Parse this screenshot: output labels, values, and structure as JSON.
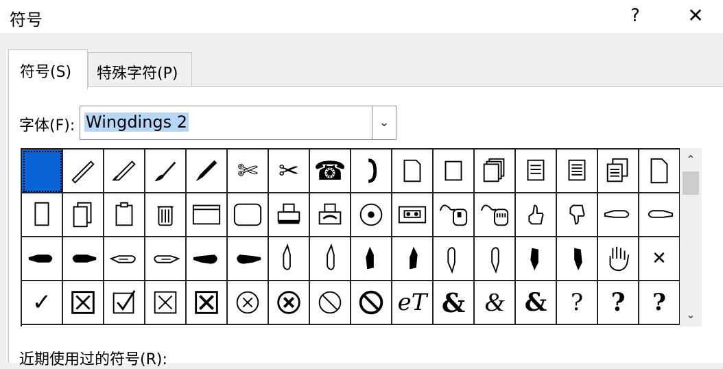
{
  "window": {
    "title": "符号",
    "help_label": "?",
    "close_label": "✕"
  },
  "tabs": [
    {
      "label": "符号(S)",
      "active": true
    },
    {
      "label": "特殊字符(P)",
      "active": false
    }
  ],
  "font": {
    "label": "字体(F):",
    "value": "Wingdings 2"
  },
  "symbol_grid": {
    "selected_index": 0,
    "rows": [
      [
        "selected",
        "pen-icon",
        "fountain-pen-icon",
        "brush-icon",
        "pencil-icon",
        "scissors-open-icon",
        "scissors-icon",
        "telephone-icon",
        "handset-icon",
        "document-folded-icon",
        "blank-page-icon",
        "stacked-pages-icon",
        "text-page-icon",
        "lined-page-icon",
        "stacked-text-pages-icon",
        "page-icon"
      ],
      [
        "tall-page-icon",
        "page-stack-icon",
        "clipboard-icon",
        "trash-can-icon",
        "window-icon",
        "rounded-rectangle-icon",
        "printer-icon",
        "fax-icon",
        "disc-icon",
        "cassette-icon",
        "mouse-icon",
        "mouse-keyboard-icon",
        "thumbs-up-icon",
        "thumbs-down-icon",
        "hand-point-left-icon",
        "hand-point-right-icon"
      ],
      [
        "black-hand-point-left-icon",
        "black-hand-point-right-icon",
        "outline-hand-left-icon",
        "outline-hand-right-icon",
        "black-fist-left-icon",
        "black-fist-right-icon",
        "hand-point-up-icon",
        "hand-point-up-alt-icon",
        "black-hand-up-icon",
        "black-hand-up-alt-icon",
        "hand-point-down-icon",
        "hand-point-down-alt-icon",
        "black-hand-down-icon",
        "black-hand-down-alt-icon",
        "open-hand-icon",
        "x-mark-icon"
      ],
      [
        "check-mark-icon",
        "x-box-icon",
        "check-box-icon",
        "x-box-thin-icon",
        "x-box-bold-icon",
        "circle-x-icon",
        "circle-x-bold-icon",
        "prohibited-icon",
        "prohibited-bold-icon",
        "et-ligature-icon",
        "ampersand-bold-icon",
        "ampersand-italic-icon",
        "ampersand-serif-icon",
        "interrobang-icon",
        "interrobang-bold-icon",
        "interrobang-alt-icon"
      ]
    ],
    "text_glyphs": {
      "check-mark-icon": "✓",
      "et-ligature-icon": "eT",
      "ampersand-bold-icon": "&",
      "ampersand-italic-icon": "&",
      "ampersand-serif-icon": "&",
      "interrobang-icon": "?",
      "interrobang-bold-icon": "?",
      "interrobang-alt-icon": "?",
      "x-mark-icon": "✕",
      "telephone-icon": "☎",
      "scissors-icon": "✂",
      "scissors-open-icon": "✄"
    }
  },
  "scrollbar": {
    "up_label": "⌃",
    "down_label": "⌄"
  },
  "recent": {
    "label": "近期使用过的符号(R):"
  }
}
